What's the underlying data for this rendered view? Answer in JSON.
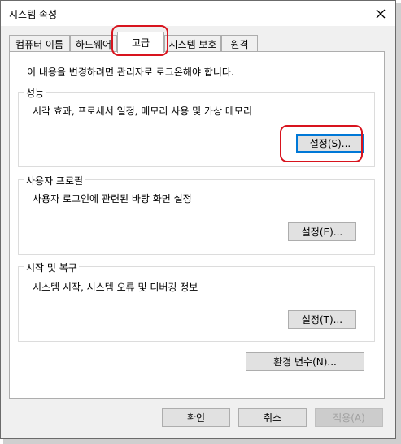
{
  "window": {
    "title": "시스템 속성"
  },
  "tabs": [
    {
      "label": "컴퓨터 이름",
      "active": false
    },
    {
      "label": "하드웨어",
      "active": false
    },
    {
      "label": "고급",
      "active": true
    },
    {
      "label": "시스템 보호",
      "active": false
    },
    {
      "label": "원격",
      "active": false
    }
  ],
  "panel": {
    "admin_notice": "이 내용을 변경하려면 관리자로 로그온해야 합니다.",
    "performance": {
      "title": "성능",
      "description": "시각 효과, 프로세서 일정, 메모리 사용 및 가상 메모리",
      "button": "설정(S)..."
    },
    "user_profiles": {
      "title": "사용자 프로필",
      "description": "사용자 로그인에 관련된 바탕 화면 설정",
      "button": "설정(E)..."
    },
    "startup_recovery": {
      "title": "시작 및 복구",
      "description": "시스템 시작, 시스템 오류 및 디버깅 정보",
      "button": "설정(T)..."
    },
    "env_button": "환경 변수(N)..."
  },
  "footer": {
    "ok": "확인",
    "cancel": "취소",
    "apply": "적용(A)"
  },
  "colors": {
    "highlight": "#d8141e",
    "focus": "#0078d7"
  }
}
